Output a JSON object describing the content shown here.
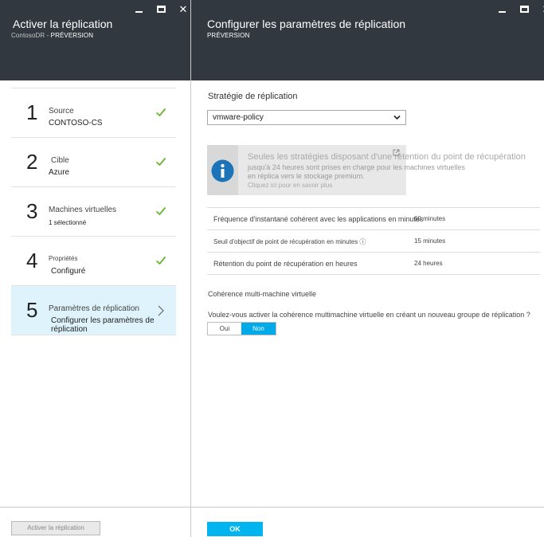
{
  "left_blade": {
    "title": "Activer la réplication",
    "subtitle_prefix": "ContosoDR - ",
    "subtitle_tag": "PRÉVERSION",
    "steps": [
      {
        "number": "1",
        "label": "Source",
        "value": "CONTOSO-CS",
        "status": "complete"
      },
      {
        "number": "2",
        "label": "Cible",
        "value": "Azure",
        "status": "complete"
      },
      {
        "number": "3",
        "label": "Machines virtuelles",
        "value": "1 sélectionné",
        "status": "complete"
      },
      {
        "number": "4",
        "label": "Propriétés",
        "value": "Configuré",
        "status": "complete"
      },
      {
        "number": "5",
        "label": "Paramètres de réplication",
        "value": "Configurer les paramètres de réplication",
        "status": "active"
      }
    ],
    "footer_button": "Activer la réplication"
  },
  "right_blade": {
    "title": "Configurer les paramètres de réplication",
    "subtitle_tag": "PRÉVERSION",
    "policy_label": "Stratégie de réplication",
    "policy_selected": "vmware-policy",
    "info": {
      "line1": "Seules les stratégies disposant d'une rétention du point de récupération",
      "line2": "jusqu'à 24 heures sont prises en charge pour les machines virtuelles",
      "line3": "en réplica vers le stockage premium.",
      "line4": "Cliquez ici pour en savoir plus",
      "icon": "info-icon"
    },
    "settings": [
      {
        "key": "Fréquence d'instantané cohérent avec les applications en minutes",
        "value": "60 minutes"
      },
      {
        "key": "Seuil d'objectif de point de récupération en minutes ⓘ",
        "value": "15 minutes"
      },
      {
        "key": "Rétention du point de récupération en heures",
        "value": "24 heures"
      }
    ],
    "multivm_title": "Cohérence multi-machine virtuelle",
    "multivm_question": "Voulez-vous activer la cohérence multimachine virtuelle en créant un nouveau groupe de réplication ?",
    "toggle_yes": "Oui",
    "toggle_no": "Non",
    "toggle_selected": "Non",
    "ok_button": "OK"
  },
  "colors": {
    "header_bg": "#32383f",
    "accent": "#00aae9",
    "check_green": "#68b52c",
    "active_step_bg": "#def3fb",
    "info_icon": "#1c73b7"
  }
}
